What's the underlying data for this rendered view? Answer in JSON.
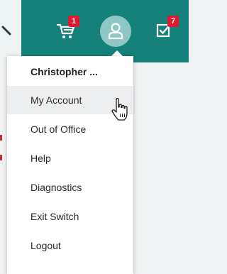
{
  "header": {
    "cart_badge": "1",
    "tasks_badge": "7",
    "icons": {
      "search": "search-icon",
      "cart": "cart-icon",
      "user": "user-icon",
      "tasks": "checkbox-icon"
    },
    "colors": {
      "bar": "#16807a",
      "badge": "#e3172d",
      "user_circle": "#8ec7c3"
    }
  },
  "menu": {
    "items": [
      {
        "label": "Christopher ..."
      },
      {
        "label": "My Account"
      },
      {
        "label": "Out of Office"
      },
      {
        "label": "Help"
      },
      {
        "label": "Diagnostics"
      },
      {
        "label": "Exit Switch"
      },
      {
        "label": "Logout"
      }
    ],
    "hovered_item": "My Account"
  }
}
